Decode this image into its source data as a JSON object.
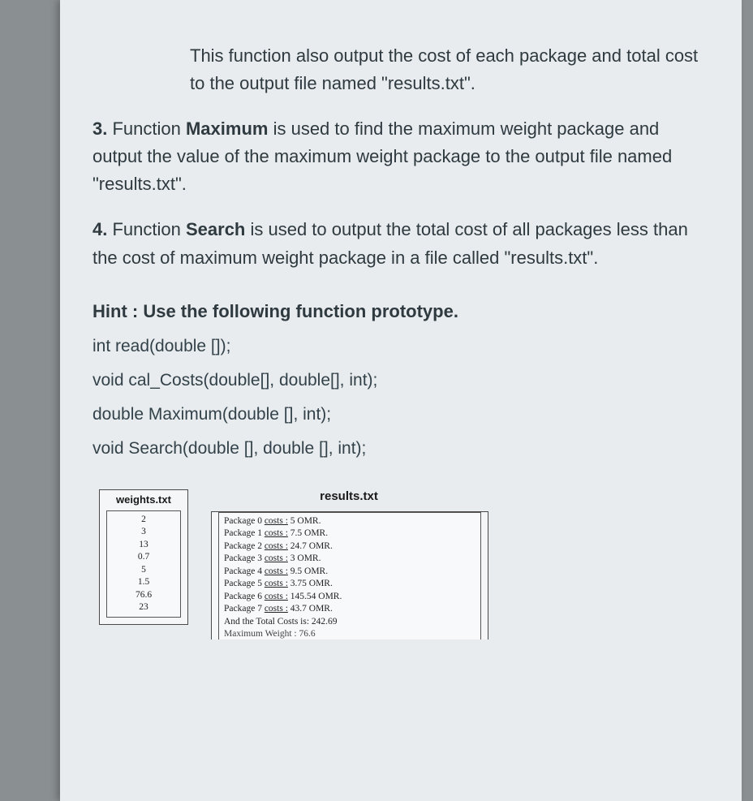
{
  "intro": "This function also output the cost of each package and total cost to the output file named \"results.txt\".",
  "item3_num": "3.",
  "item3_pre": "Function ",
  "item3_fname": "Maximum",
  "item3_rest": " is used to find the maximum weight package and output the value of the maximum weight package to the output file named \"results.txt\".",
  "item4_num": "4.",
  "item4_pre": "Function ",
  "item4_fname": "Search",
  "item4_rest": " is used to output the total cost of all packages less than the cost of maximum weight package in a file called \"results.txt\".",
  "hint_title": "Hint : Use the following function prototype.",
  "proto1": "int read(double []);",
  "proto2": "void cal_Costs(double[], double[], int);",
  "proto3": "double Maximum(double [], int);",
  "proto4": "void Search(double [], double [], int);",
  "weights_title": "weights.txt",
  "weights": [
    "2",
    "3",
    "13",
    "0.7",
    "5",
    "1.5",
    "76.6",
    "23"
  ],
  "results_title": "results.txt",
  "result_lines": [
    {
      "pre": "Package 0 ",
      "mid": "costs :",
      "post": " 5 OMR."
    },
    {
      "pre": "Package 1 ",
      "mid": "costs :",
      "post": " 7.5 OMR."
    },
    {
      "pre": "Package 2 ",
      "mid": "costs :",
      "post": " 24.7 OMR."
    },
    {
      "pre": "Package 3 ",
      "mid": "costs :",
      "post": " 3 OMR."
    },
    {
      "pre": "Package 4 ",
      "mid": "costs :",
      "post": " 9.5 OMR."
    },
    {
      "pre": "Package 5 ",
      "mid": "costs :",
      "post": " 3.75 OMR."
    },
    {
      "pre": "Package 6 ",
      "mid": "costs :",
      "post": " 145.54 OMR."
    },
    {
      "pre": "Package 7 ",
      "mid": "costs :",
      "post": " 43.7 OMR."
    }
  ],
  "total_line": "And the Total Costs is: 242.69",
  "cutoff_line": "Maximum Weight : 76.6"
}
